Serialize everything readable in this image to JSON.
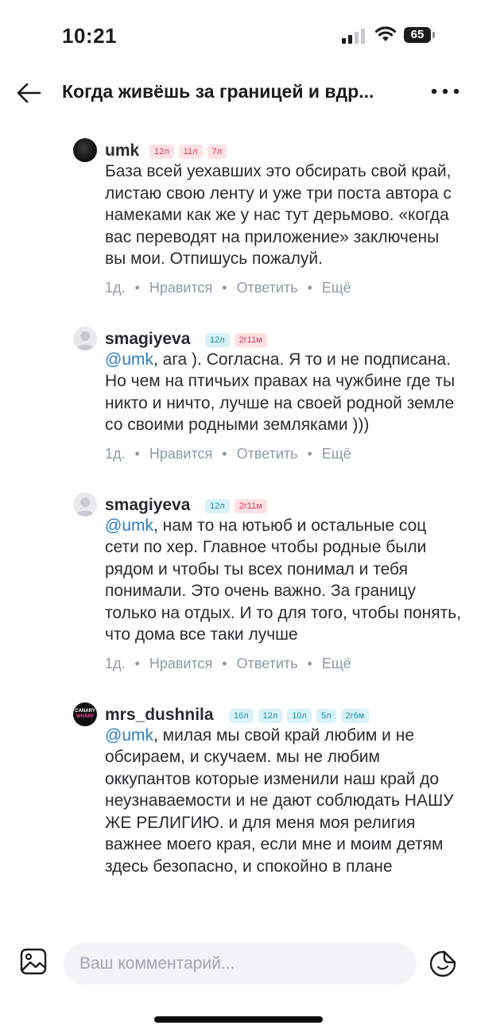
{
  "status": {
    "time": "10:21",
    "battery": "65",
    "icons": [
      "signal-icon",
      "wifi-icon",
      "battery-icon"
    ]
  },
  "header": {
    "title": "Когда живёшь за границей и вдр...",
    "back_icon": "back-arrow-icon",
    "more_icon": "more-dots-icon"
  },
  "comments": [
    {
      "username": "umk",
      "avatar": "dark-photo",
      "badges": [
        {
          "text": "12л",
          "color": "pink"
        },
        {
          "text": "11л",
          "color": "pink"
        },
        {
          "text": "7л",
          "color": "pink"
        }
      ],
      "mention": "",
      "text": "База всей уехавших это обсирать свой край, листаю свою ленту и уже три поста автора  с намеками как же у нас тут дерьмово. «когда вас переводят на приложение» заключены вы мои. Отпишусь пожалуй.",
      "meta": {
        "age": "1д.",
        "like": "Нравится",
        "reply": "Ответить",
        "more": "Ещё"
      }
    },
    {
      "username": "smagiyeva",
      "avatar": "placeholder",
      "badges": [
        {
          "text": "12л",
          "color": "teal"
        },
        {
          "text": "2г11м",
          "color": "pink"
        }
      ],
      "mention": "@umk",
      "text": ", ага ). Согласна. Я то и не подписана. Но чем на птичьих правах на чужбине где ты никто и ничто, лучше на своей родной земле со своими родными земляками )))",
      "meta": {
        "age": "1д.",
        "like": "Нравится",
        "reply": "Ответить",
        "more": "Ещё"
      }
    },
    {
      "username": "smagiyeva",
      "avatar": "placeholder",
      "badges": [
        {
          "text": "12л",
          "color": "teal"
        },
        {
          "text": "2г11м",
          "color": "pink"
        }
      ],
      "mention": "@umk",
      "text": ", нам то на ютьюб и остальные соц сети по хер. Главное чтобы родные были рядом и чтобы ты всех понимал и тебя понимали. Это очень важно. За границу только на отдых. И то для того, чтобы понять, что дома все таки лучше",
      "meta": {
        "age": "1д.",
        "like": "Нравится",
        "reply": "Ответить",
        "more": "Ещё"
      }
    },
    {
      "username": "mrs_dushnila",
      "avatar": "canary-logo",
      "avatar_text": [
        "CANARY",
        "WHARF"
      ],
      "badges": [
        {
          "text": "16л",
          "color": "teal"
        },
        {
          "text": "12л",
          "color": "teal"
        },
        {
          "text": "10л",
          "color": "teal"
        },
        {
          "text": "5л",
          "color": "teal"
        },
        {
          "text": "2г6м",
          "color": "teal"
        }
      ],
      "mention": "@umk",
      "text": ", милая мы свой край любим и не обсираем, и скучаем. мы не любим оккупантов которые изменили наш край до неузнаваемости и не дают соблюдать НАШУ ЖЕ РЕЛИГИЮ. и для меня моя религия важнее моего края, если мне и моим детям здесь безопасно, и спокойно в плане",
      "meta": {
        "age": "1д.",
        "like": "Нравится",
        "reply": "Ответить",
        "more": "Ещё"
      }
    }
  ],
  "composer": {
    "placeholder": "Ваш комментарий...",
    "value": "",
    "image_icon": "image-icon",
    "sticker_icon": "sticker-icon"
  }
}
